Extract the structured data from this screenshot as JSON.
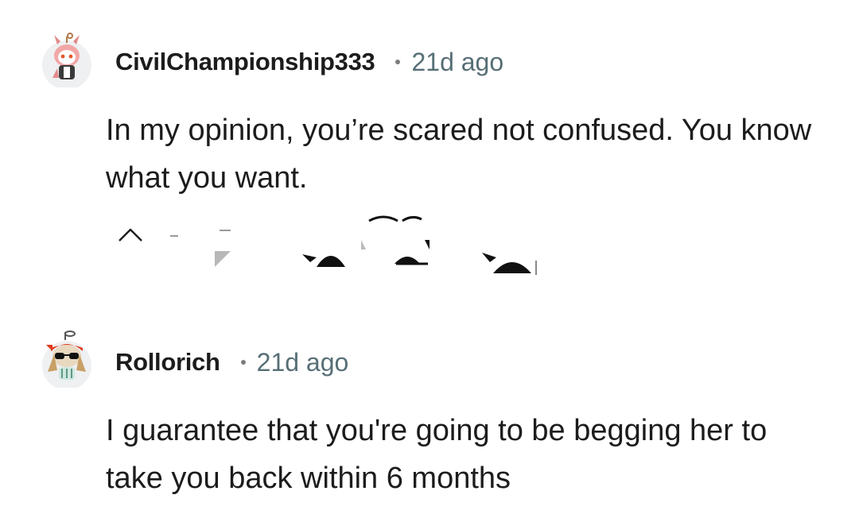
{
  "comments": [
    {
      "username": "CivilChampionship333",
      "time": "21d ago",
      "body": "In my opinion, you’re scared not confused. You know what you want.",
      "avatar_icon": "snoo-avatar-pink-cat-icon"
    },
    {
      "username": "Rollorich",
      "time": "21d ago",
      "body": "I guarantee that you're going to be begging her to take you back within 6 months",
      "avatar_icon": "snoo-avatar-sunglasses-icon"
    }
  ],
  "action_icons": [
    "upvote-icon",
    "downvote-icon",
    "reply-icon",
    "award-icon",
    "share-icon"
  ],
  "colors": {
    "username": "#1c1c1c",
    "meta": "#576f76",
    "body": "#1c1c1c",
    "background": "#ffffff"
  }
}
